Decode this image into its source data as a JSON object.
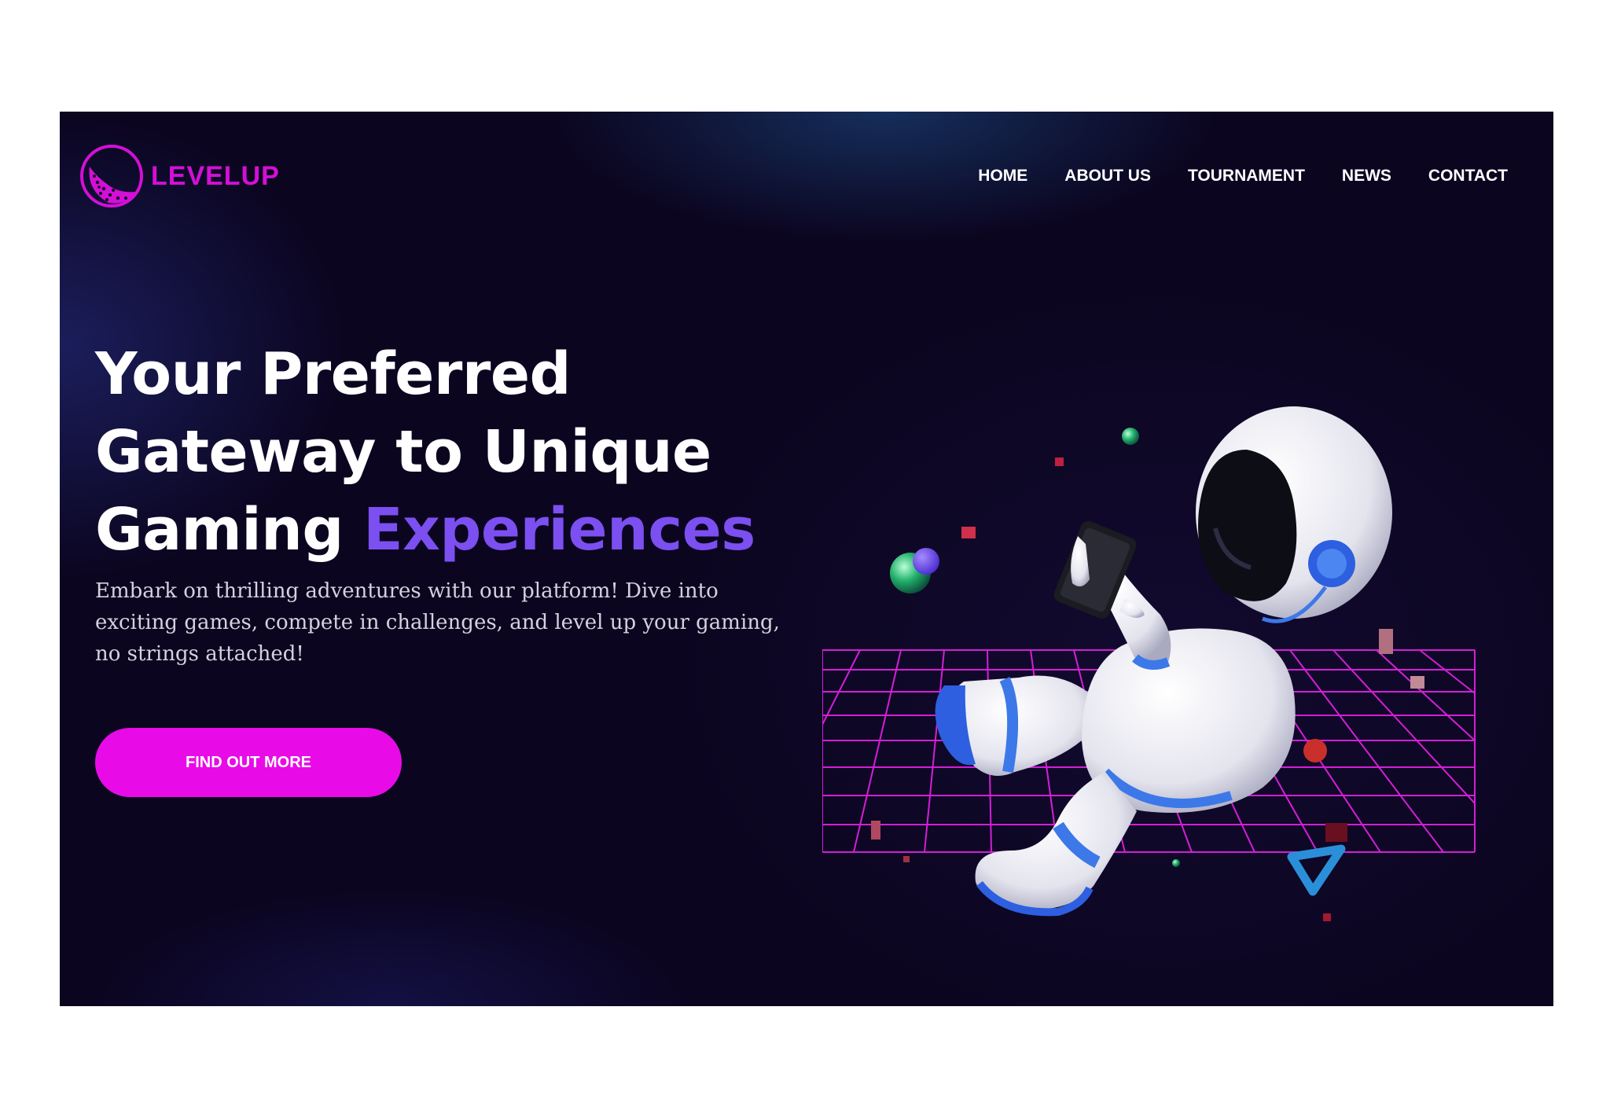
{
  "brand": {
    "name": "LEVELUP",
    "accent_color": "#d40fd6",
    "logo_icon": "golf-ball-icon"
  },
  "nav": {
    "items": [
      {
        "label": "HOME"
      },
      {
        "label": "ABOUT US"
      },
      {
        "label": "TOURNAMENT"
      },
      {
        "label": "NEWS"
      },
      {
        "label": "CONTACT"
      }
    ]
  },
  "hero": {
    "headline_line1": "Your Preferred",
    "headline_line2": "Gateway to Unique",
    "headline_line3_plain": "Gaming ",
    "headline_line3_accent": "Experiences",
    "headline_accent_color": "#7c4ff0",
    "subtext": "Embark on thrilling adventures with our platform! Dive into exciting games, compete in challenges, and level up your gaming, no strings attached!",
    "cta_label": "FIND OUT MORE",
    "cta_color": "#e80be8"
  },
  "illustration": {
    "subject": "astronaut-gaming-illustration",
    "grid_color": "#e020e0"
  },
  "colors": {
    "background": "#0b0520",
    "frame_border": "#ffffff"
  }
}
